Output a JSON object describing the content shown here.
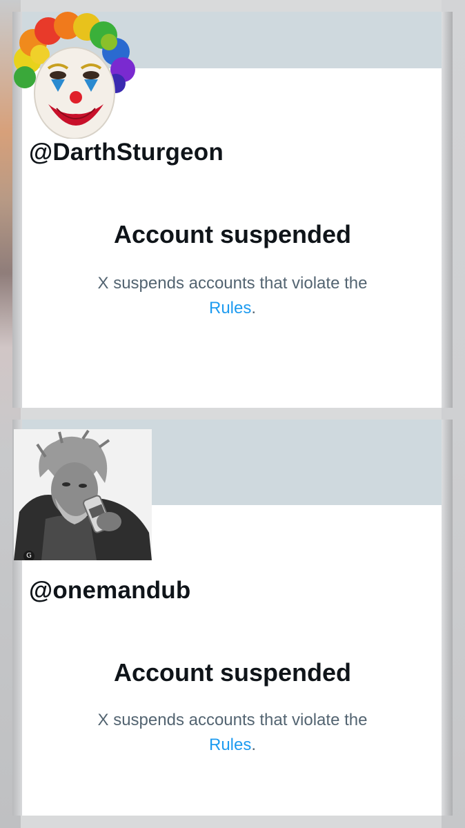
{
  "posts": [
    {
      "handle": "@DarthSturgeon",
      "status_title": "Account suspended",
      "status_text": "X suspends accounts that violate the",
      "rules_link": "Rules",
      "period": "."
    },
    {
      "handle": "@onemandub",
      "status_title": "Account suspended",
      "status_text": "X suspends accounts that violate the",
      "rules_link": "Rules",
      "period": "."
    }
  ],
  "colors": {
    "banner": "#cfd9de",
    "link": "#1d9bf0",
    "secondary_text": "#536471",
    "primary_text": "#0f1419"
  },
  "icons": [
    "clown-avatar-icon",
    "old-man-avatar-icon",
    "google-lens-icon"
  ]
}
